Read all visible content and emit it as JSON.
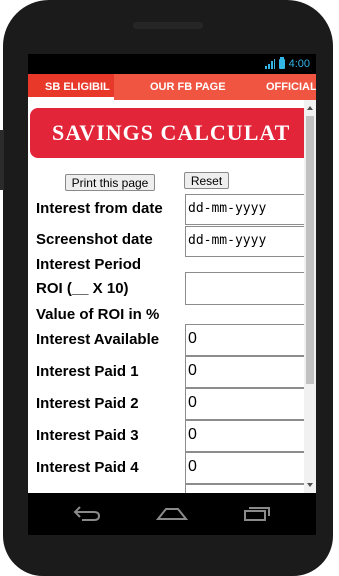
{
  "status": {
    "time": "4:00"
  },
  "tabs": [
    {
      "label": "SB ELIGIBIL"
    },
    {
      "label": "OUR FB PAGE"
    },
    {
      "label": "OFFICIAL"
    }
  ],
  "banner": {
    "title": "SAVINGS CALCULAT"
  },
  "buttons": {
    "print": "Print this page",
    "reset": "Reset"
  },
  "fields": {
    "interest_from_date": {
      "label": "Interest from date",
      "placeholder": "dd-mm-yyyy"
    },
    "screenshot_date": {
      "label": "Screenshot date",
      "placeholder": "dd-mm-yyyy"
    },
    "interest_period": {
      "label": "Interest Period",
      "value": ""
    },
    "roi_x10": {
      "label": "ROI (__ X 10)"
    },
    "roi_percent": {
      "label": "Value of ROI in %"
    },
    "interest_available": {
      "label": "Interest Available",
      "value": "0"
    },
    "interest_paid_1": {
      "label": "Interest Paid 1",
      "value": "0"
    },
    "interest_paid_2": {
      "label": "Interest Paid 2",
      "value": "0"
    },
    "interest_paid_3": {
      "label": "Interest Paid 3",
      "value": "0"
    },
    "interest_paid_4": {
      "label": "Interest Paid 4",
      "value": "0"
    }
  },
  "icons": {
    "signal": "signal-icon",
    "battery": "battery-icon",
    "back": "back-icon",
    "home": "home-icon",
    "recents": "recent-apps-icon"
  },
  "colors": {
    "tab_bar": "#f05542",
    "banner": "#e3253a",
    "status_accent": "#33b5e5"
  }
}
